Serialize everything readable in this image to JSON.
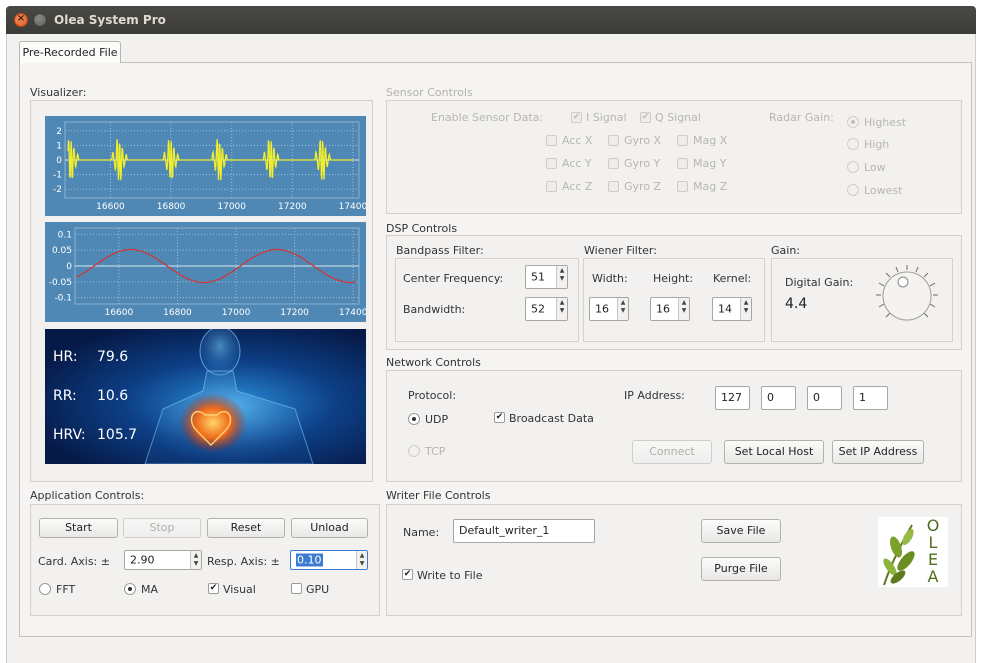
{
  "window": {
    "title": "Olea System Pro"
  },
  "tabs": [
    {
      "label": "Pre-Recorded File"
    }
  ],
  "visualizer": {
    "title": "Visualizer:",
    "chart1": {
      "y_ticks": [
        "2",
        "1",
        "0",
        "-1",
        "-2"
      ],
      "x_ticks": [
        "16600",
        "16800",
        "17000",
        "17200",
        "17400"
      ]
    },
    "chart2": {
      "y_ticks": [
        "0.1",
        "0.05",
        "0",
        "-0.05",
        "-0.1"
      ],
      "x_ticks": [
        "16600",
        "16800",
        "17000",
        "17200",
        "17400"
      ]
    },
    "vitals": {
      "hr_label": "HR:",
      "hr_value": "79.6",
      "rr_label": "RR:",
      "rr_value": "10.6",
      "hrv_label": "HRV:",
      "hrv_value": "105.7"
    }
  },
  "chart_data": [
    {
      "type": "line",
      "title": "",
      "xlabel": "",
      "ylabel": "",
      "xlim": [
        16450,
        17420
      ],
      "ylim": [
        -2.6,
        2.6
      ],
      "series": [
        {
          "color": "#f2ef2a",
          "baseline": 0,
          "beat_positions": [
            16470,
            16630,
            16800,
            16960,
            17130,
            17300
          ],
          "beat_amplitude": 1.6
        }
      ],
      "grid": true
    },
    {
      "type": "line",
      "title": "",
      "xlabel": "",
      "ylabel": "",
      "xlim": [
        16450,
        17420
      ],
      "ylim": [
        -0.12,
        0.12
      ],
      "series": [
        {
          "color": "#d63232",
          "amplitude": 0.052,
          "period": 500,
          "peak_x": 16640
        }
      ],
      "grid": true
    }
  ],
  "sensor_controls": {
    "title": "Sensor Controls",
    "enable_label": "Enable Sensor Data:",
    "i_signal": "I Signal",
    "q_signal": "Q Signal",
    "acc_x": "Acc X",
    "gyro_x": "Gyro X",
    "mag_x": "Mag X",
    "acc_y": "Acc Y",
    "gyro_y": "Gyro Y",
    "mag_y": "Mag Y",
    "acc_z": "Acc Z",
    "gyro_z": "Gyro Z",
    "mag_z": "Mag Z",
    "radar_gain_label": "Radar Gain:",
    "gain_highest": "Highest",
    "gain_high": "High",
    "gain_low": "Low",
    "gain_lowest": "Lowest"
  },
  "dsp_controls": {
    "title": "DSP Controls",
    "bandpass_title": "Bandpass Filter:",
    "center_freq_label": "Center Frequency:",
    "center_freq_value": "51",
    "bandwidth_label": "Bandwidth:",
    "bandwidth_value": "52",
    "wiener_title": "Wiener Filter:",
    "width_label": "Width:",
    "width_value": "16",
    "height_label": "Height:",
    "height_value": "16",
    "kernel_label": "Kernel:",
    "kernel_value": "14",
    "gain_title": "Gain:",
    "digital_gain_label": "Digital Gain:",
    "digital_gain_value": "4.4"
  },
  "network_controls": {
    "title": "Network Controls",
    "protocol_label": "Protocol:",
    "udp_label": "UDP",
    "tcp_label": "TCP",
    "broadcast_label": "Broadcast Data",
    "ip_label": "IP Address:",
    "ip1": "127",
    "ip2": "0",
    "ip3": "0",
    "ip4": "1",
    "connect_label": "Connect",
    "local_host_label": "Set Local Host",
    "set_ip_label": "Set IP Address"
  },
  "application_controls": {
    "title": "Application Controls:",
    "start_label": "Start",
    "stop_label": "Stop",
    "reset_label": "Reset",
    "unload_label": "Unload",
    "card_axis_label": "Card. Axis: ±",
    "card_axis_value": "2.90",
    "resp_axis_label": "Resp. Axis: ±",
    "resp_axis_value": "0.10",
    "fft_label": "FFT",
    "ma_label": "MA",
    "visual_label": "Visual",
    "gpu_label": "GPU"
  },
  "writer_controls": {
    "title": "Writer File Controls",
    "name_label": "Name:",
    "name_value": "Default_writer_1",
    "save_label": "Save File",
    "purge_label": "Purge File",
    "write_label": "Write to File"
  },
  "logo": {
    "letters": [
      "O",
      "L",
      "E",
      "A"
    ]
  },
  "colors": {
    "chart_bg": "#4f88b4",
    "ecg_line": "#f2ef2a",
    "resp_line": "#d63232",
    "accent_orange": "#e15a20",
    "selection": "#3d7bd1"
  }
}
